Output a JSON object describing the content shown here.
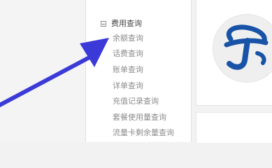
{
  "sidebar": {
    "group_title": "费用查询",
    "items": [
      {
        "label": "余额查询"
      },
      {
        "label": "话费查询"
      },
      {
        "label": "账单查询"
      },
      {
        "label": "详单查询"
      },
      {
        "label": "充值记录查询"
      },
      {
        "label": "套餐使用量查询"
      },
      {
        "label": "流量卡剩余量查询"
      }
    ]
  },
  "colors": {
    "annotation_arrow": "#3b3ad8",
    "logo_blue": "#1853a8",
    "item_text": "#8c8c8c"
  },
  "icons": {
    "collapse": "minus-square-icon",
    "logo": "telecom-logo-icon",
    "pointer": "annotation-arrow-icon"
  }
}
